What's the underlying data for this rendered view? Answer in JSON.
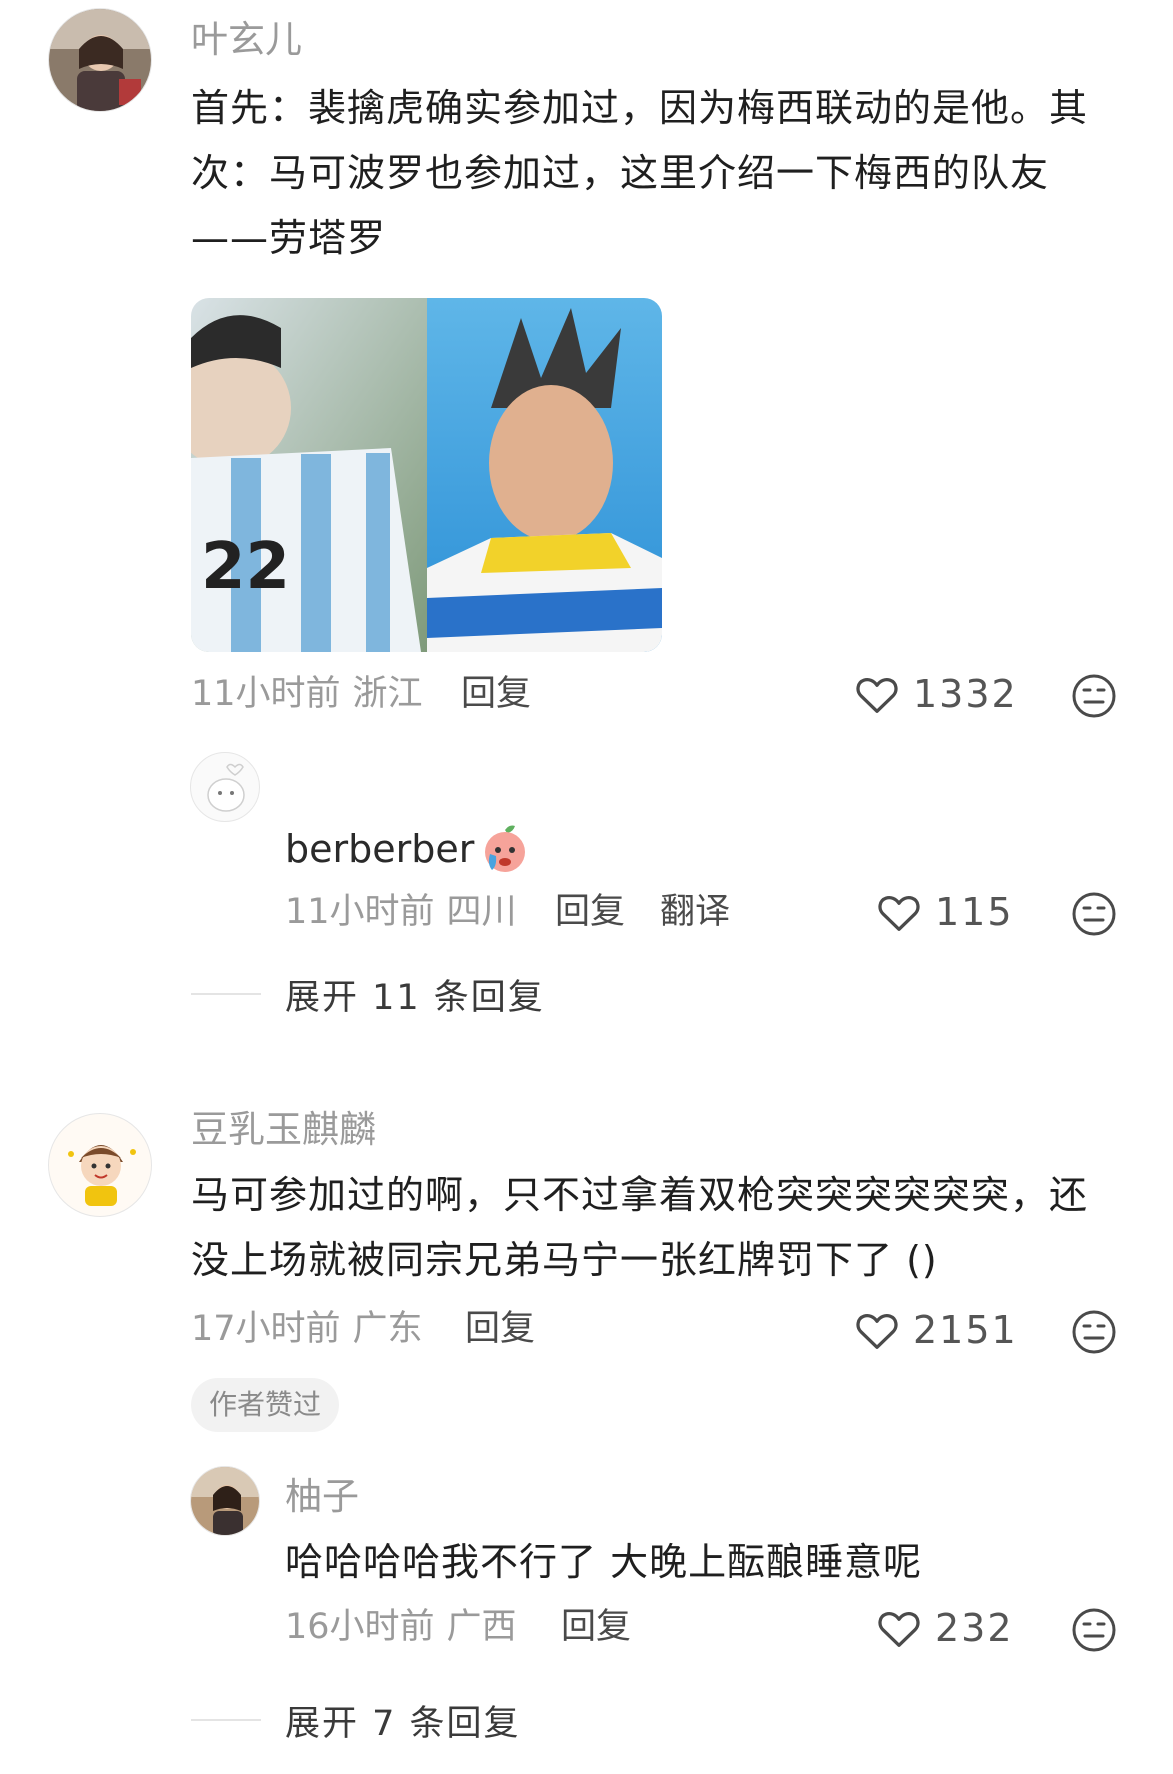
{
  "comments": [
    {
      "username": "叶玄儿",
      "text": "首先：裴擒虎确实参加过，因为梅西联动的是他。其次：马可波罗也参加过，这里介绍一下梅西的队友——劳塔罗",
      "time": "11小时前",
      "location": "浙江",
      "reply_label": "回复",
      "likes": "1332",
      "sub_reply": {
        "username": "berberber",
        "time": "11小时前",
        "location": "四川",
        "reply_label": "回复",
        "translate_label": "翻译",
        "likes": "115"
      },
      "expand_label": "展开 11 条回复"
    },
    {
      "username": "豆乳玉麒麟",
      "text": "马可参加过的啊，只不过拿着双枪突突突突突突，还没上场就被同宗兄弟马宁一张红牌罚下了 ()",
      "time": "17小时前",
      "location": "广东",
      "reply_label": "回复",
      "likes": "2151",
      "badge": "作者赞过",
      "sub_reply": {
        "username": "柚子",
        "text": "哈哈哈哈我不行了 大晚上酝酿睡意呢",
        "time": "16小时前",
        "location": "广西",
        "reply_label": "回复",
        "likes": "232"
      },
      "expand_label": "展开 7 条回复"
    }
  ],
  "icons": {
    "like": "heart-outline-icon",
    "dislike": "neutral-face-icon"
  },
  "colors": {
    "meta_gray": "#9a9a9a",
    "badge_bg": "#f2f2f2",
    "divider": "#e4e4e4"
  }
}
